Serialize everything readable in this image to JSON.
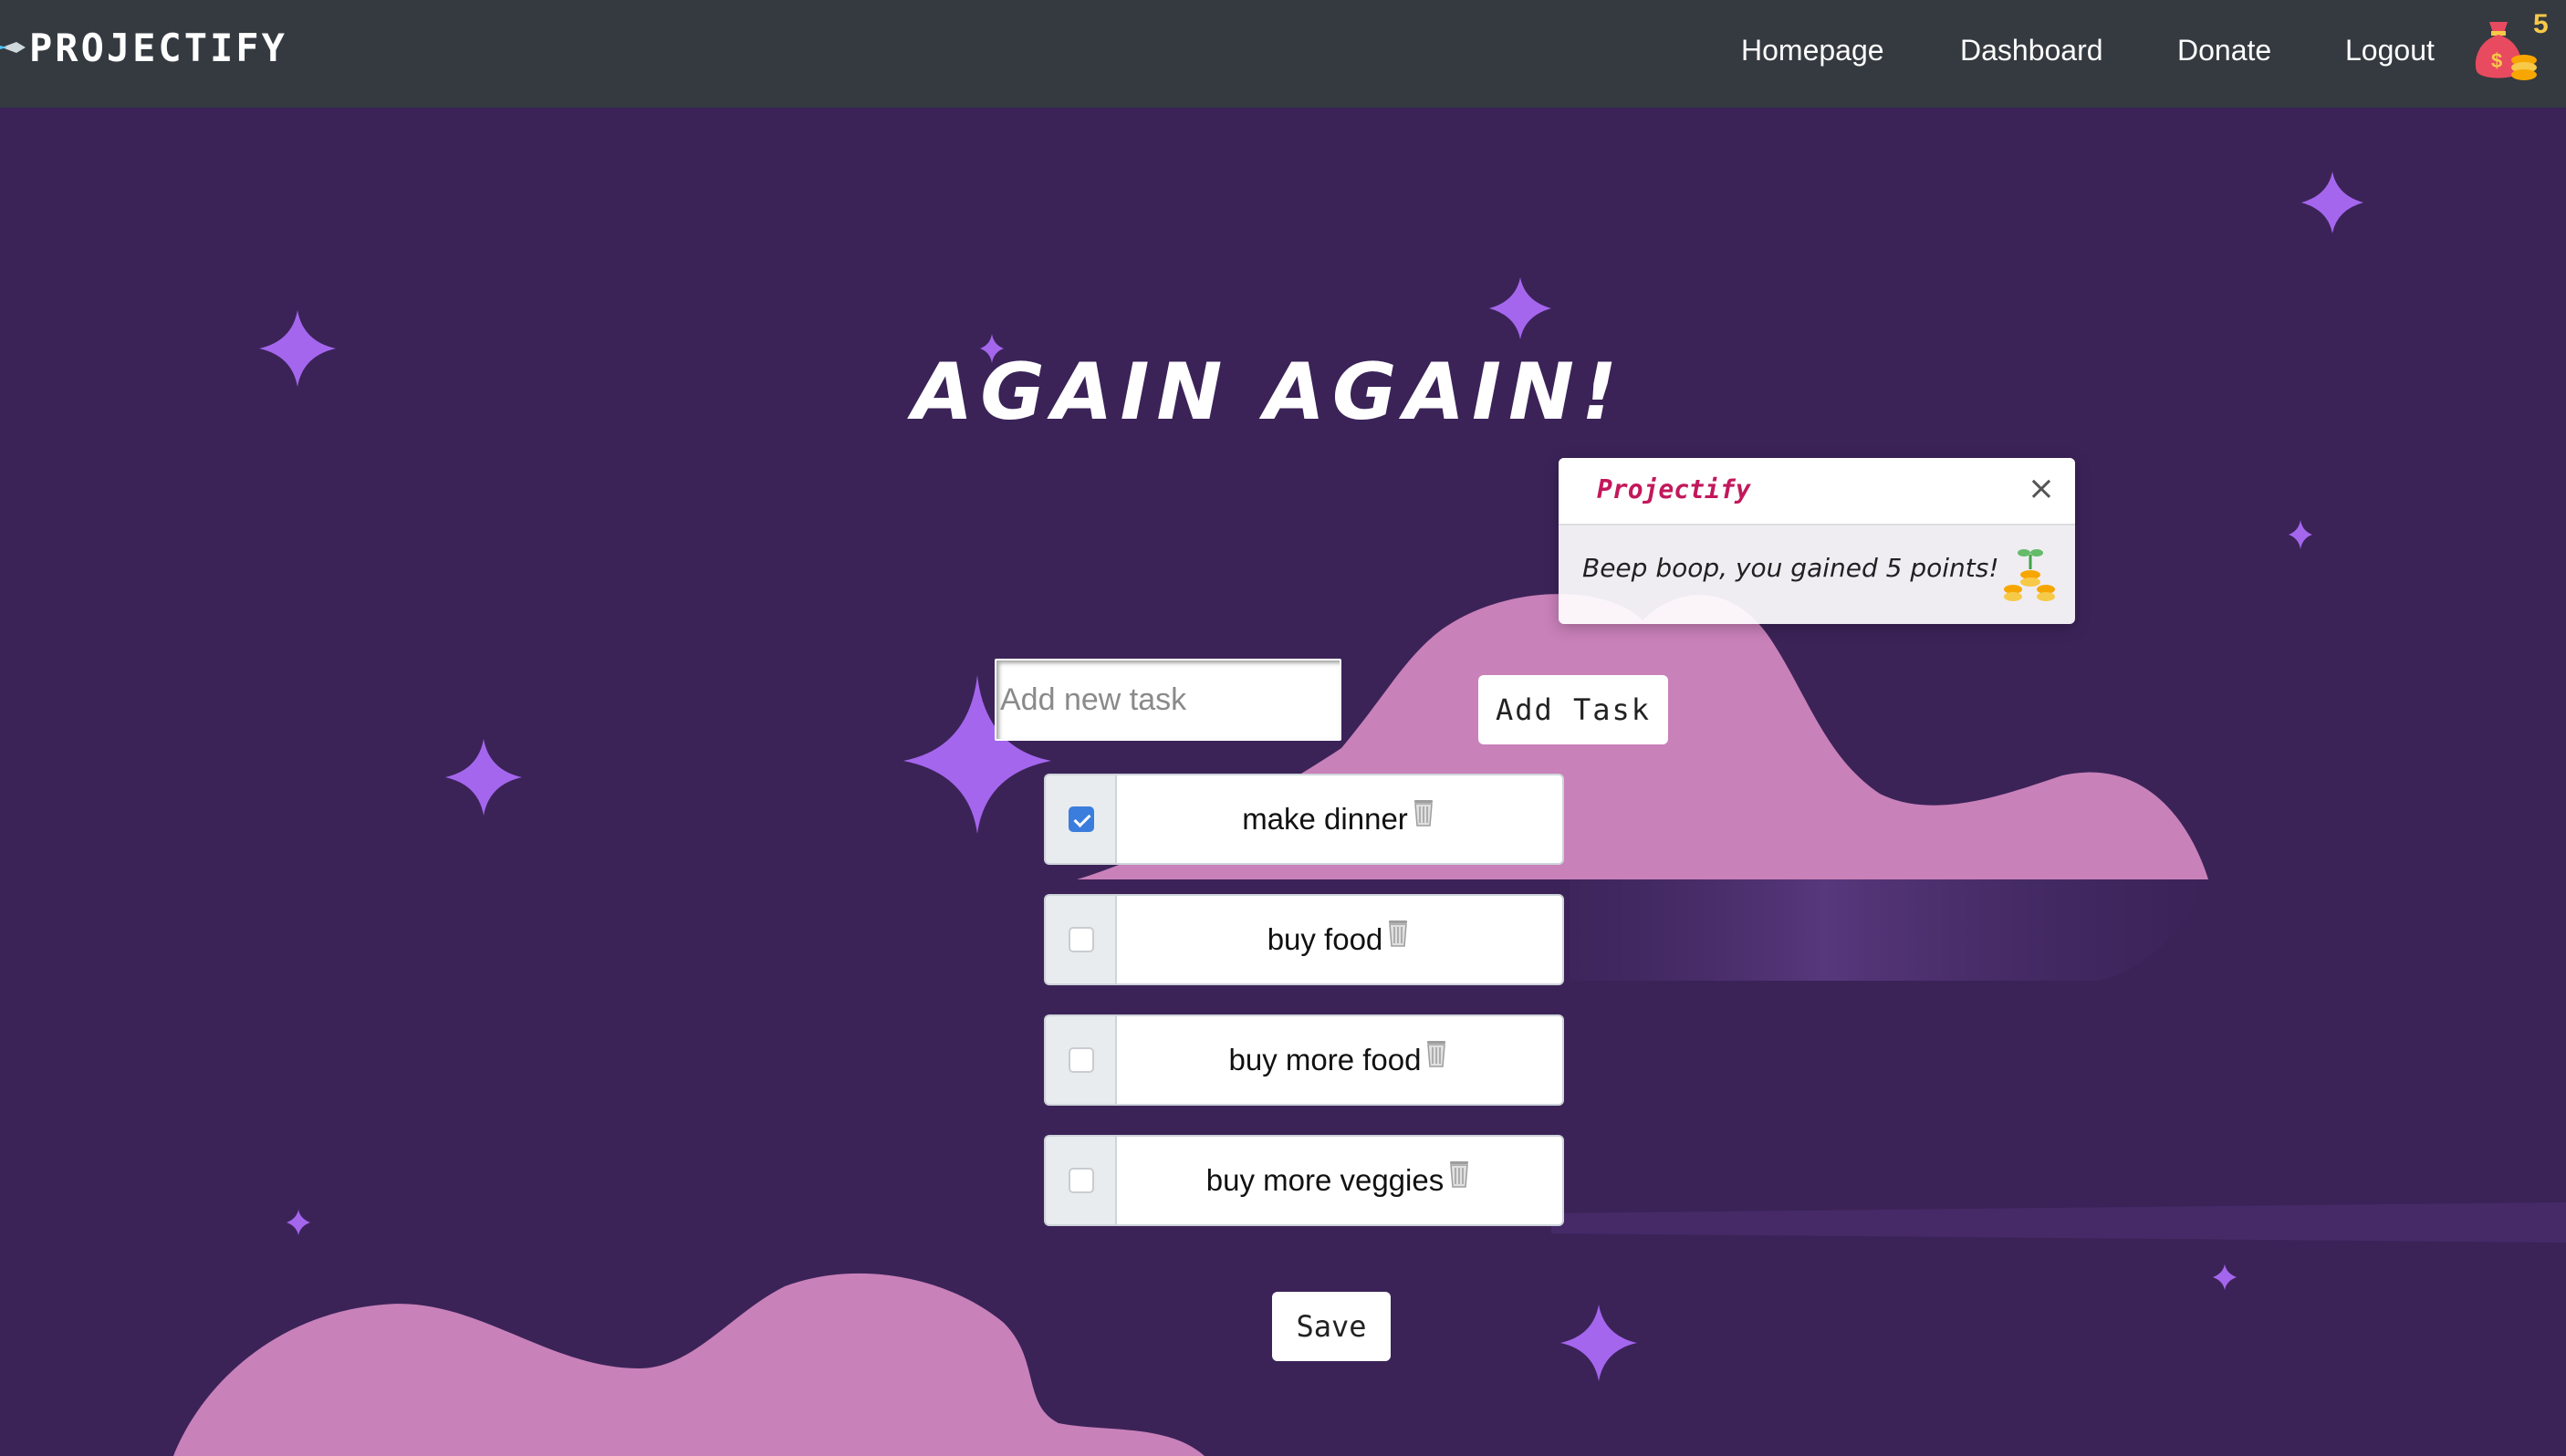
{
  "navbar": {
    "brand": "PROJECTIFY",
    "links": [
      "Homepage",
      "Dashboard",
      "Donate",
      "Logout"
    ],
    "points": "5"
  },
  "main": {
    "headline": "AGAIN AGAIN!",
    "toast": {
      "title": "Projectify",
      "close": "×",
      "message": "Beep boop, you gained 5 points!"
    },
    "input_placeholder": "Add new task",
    "add_label": "Add Task",
    "tasks": [
      {
        "label": "make dinner",
        "checked": true
      },
      {
        "label": "buy food",
        "checked": false
      },
      {
        "label": "buy more food",
        "checked": false
      },
      {
        "label": "buy more veggies",
        "checked": false
      }
    ],
    "save_label": "Save"
  },
  "colors": {
    "navbar": "#343a40",
    "background": "#3b2358",
    "cloud": "#c981b9",
    "sparkle": "#a566ee",
    "toast_title": "#c2185b",
    "checkbox": "#3b7ddd",
    "points": "#f7c948"
  },
  "icons": {
    "brand": "rocket-icon",
    "points": "money-bag-icon",
    "toast": "coins-sprout-icon",
    "task_action": "trash-icon"
  }
}
